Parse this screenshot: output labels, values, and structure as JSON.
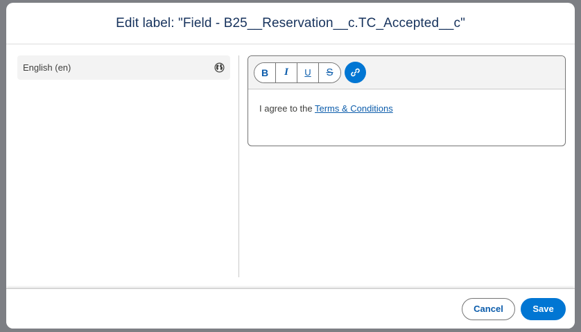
{
  "modal": {
    "title": "Edit label: \"Field - B25__Reservation__c.TC_Accepted__c\""
  },
  "language": {
    "label": "English (en)",
    "icon": "globe-icon"
  },
  "toolbar": {
    "bold": "B",
    "italic": "I",
    "underline": "U",
    "strikethrough": "S",
    "link_icon": "link-icon"
  },
  "editor": {
    "text_before": "I agree to the ",
    "link_text": "Terms & Conditions"
  },
  "footer": {
    "cancel_label": "Cancel",
    "save_label": "Save"
  },
  "colors": {
    "accent": "#0176d3",
    "link": "#0b5cab",
    "title": "#16325c"
  }
}
